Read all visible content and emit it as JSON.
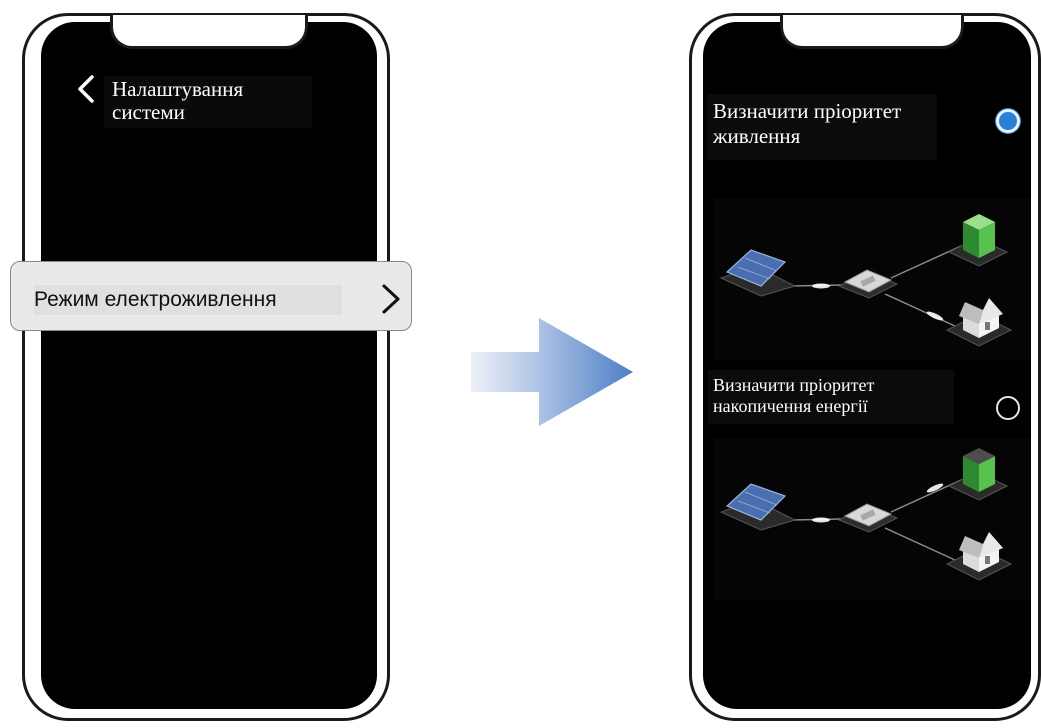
{
  "left_screen": {
    "title": "Налаштування системи",
    "menu_item_label": "Режим електроживлення"
  },
  "right_screen": {
    "options": [
      {
        "label": "Визначити пріоритет живлення",
        "selected": true
      },
      {
        "label": "Визначити пріоритет накопичення енергії",
        "selected": false
      }
    ]
  },
  "colors": {
    "screen_background": "#000000",
    "radio_selected": "#2a7fd6",
    "battery_green": "#3fae3a",
    "arrow_gradient_start": "#eef1f7",
    "arrow_gradient_end": "#4d7fc8"
  },
  "icons": {
    "back": "chevron-left-icon",
    "menu_chevron": "chevron-right-icon",
    "flow_arrow": "arrow-right-icon",
    "solar": "solar-panel-icon",
    "inverter": "inverter-icon",
    "battery": "battery-icon",
    "house": "house-icon"
  }
}
